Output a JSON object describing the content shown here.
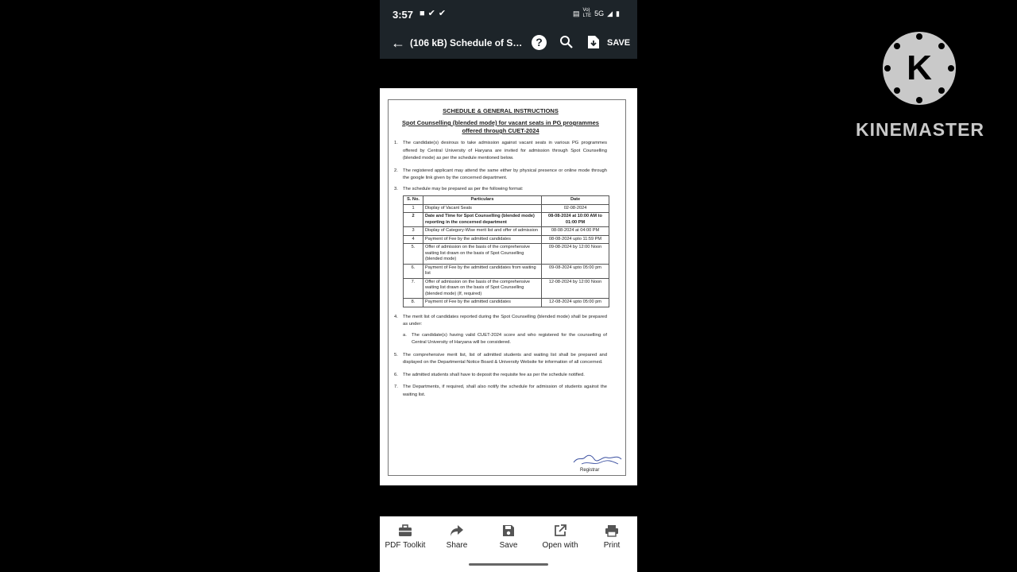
{
  "status": {
    "time": "3:57",
    "net_label_top": "Vo)",
    "net_label": "LTE",
    "signal_label": "5G"
  },
  "appbar": {
    "title": "(106 kB) Schedule of Spot C...",
    "save_label": "SAVE"
  },
  "document": {
    "heading": "SCHEDULE & GENERAL INSTRUCTIONS",
    "subheading": "Spot Counselling (blended mode) for vacant seats in PG programmes offered through CUET-2024",
    "items": [
      {
        "num": "1.",
        "text": "The candidate(s) desirous to take admission against vacant seats in various PG programmes offered by Central University of Haryana are invited for admission through Spot Counselling (blended mode) as per the schedule mentioned below."
      },
      {
        "num": "2.",
        "text": "The registered applicant may attend the same either by physical presence or online mode through the google link given by the concerned department."
      },
      {
        "num": "3.",
        "text": "The schedule may be prepared as per the following format:"
      }
    ],
    "table": {
      "headers": [
        "S. No.",
        "Particulars",
        "Date"
      ],
      "rows": [
        {
          "sno": "1",
          "particulars": "Display of Vacant Seats",
          "date": "02-08-2024"
        },
        {
          "sno": "2",
          "particulars": "Date and Time for Spot Counselling (blended mode) reporting in the concerned department",
          "date": "08-08-2024 at 10:00 AM to 01:00 PM"
        },
        {
          "sno": "3",
          "particulars": "Display of Category-Wise merit list and offer of admission",
          "date": "08-08-2024 at 04:00 PM"
        },
        {
          "sno": "4",
          "particulars": "Payment of Fee by the admitted candidates",
          "date": "08-08-2024 upto 11:59 PM"
        },
        {
          "sno": "5.",
          "particulars": "Offer of admission on the basis of the comprehensive waiting list drawn on the basis of Spot Counselling (blended mode)",
          "date": "09-08-2024 by 12:00 Noon"
        },
        {
          "sno": "6.",
          "particulars": "Payment of Fee by the admitted candidates from waiting list",
          "date": "09-08-2024 upto 05:00 pm"
        },
        {
          "sno": "7.",
          "particulars": "Offer of admission on the basis of the comprehensive waiting list drawn on the basis of Spot Counselling (blended mode) (If, required)",
          "date": "12-08-2024 by 12:00 Noon"
        },
        {
          "sno": "8.",
          "particulars": "Payment of Fee by the admitted candidates",
          "date": "12-08-2024 upto 05:00 pm"
        }
      ]
    },
    "item4": {
      "num": "4.",
      "text": "The merit list of candidates reported during the Spot Counselling (blended mode) shall be prepared as under:"
    },
    "item4a": {
      "num": "a.",
      "text": "The candidate(s) having valid CUET-2024 score and who registered for the counselling of Central University of Haryana will be considered."
    },
    "item5": {
      "num": "5.",
      "text": "The comprehensive merit list, list of admitted students and waiting list shall be prepared and displayed on the Departmental Notice Board & University Website for information of all concerned."
    },
    "item6": {
      "num": "6.",
      "text": "The admitted students shall have to deposit the requisite fee as per the schedule notified."
    },
    "item7": {
      "num": "7.",
      "text": "The Departments, if required, shall also notify the schedule for admission of students against the waiting list."
    },
    "signatory": "Registrar"
  },
  "bottom_bar": {
    "pdf_toolkit": "PDF Toolkit",
    "share": "Share",
    "save": "Save",
    "open_with": "Open with",
    "print": "Print"
  },
  "watermark": {
    "brand": "KINEMASTER",
    "logo_letter": "K"
  }
}
